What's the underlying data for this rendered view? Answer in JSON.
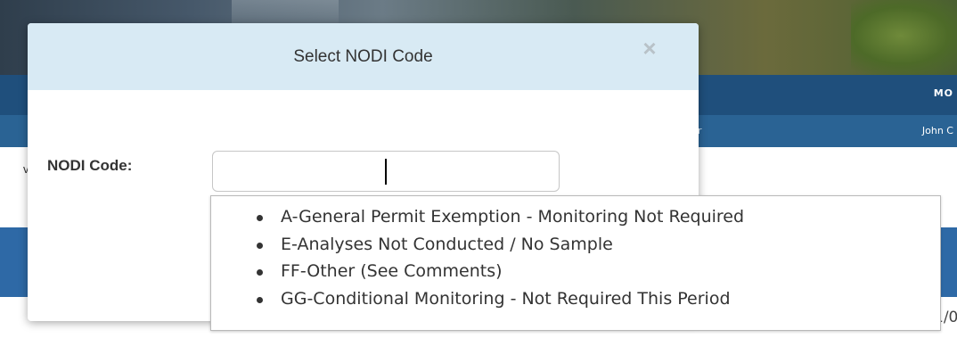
{
  "background": {
    "nav_text": "MO",
    "subnav_left": "r",
    "subnav_right": "John C",
    "edge_char": "v",
    "date_fragment": "1/0"
  },
  "modal": {
    "title": "Select NODI Code",
    "close_symbol": "×",
    "field_label": "NODI Code:",
    "input_value": "",
    "input_placeholder": ""
  },
  "dropdown": {
    "options": [
      "A-General Permit Exemption - Monitoring Not Required",
      "E-Analyses Not Conducted / No Sample",
      "FF-Other (See Comments)",
      "GG-Conditional Monitoring - Not Required This Period"
    ]
  },
  "colors": {
    "modal_header": "#d8eaf4",
    "nav": "#1f4f7c",
    "subnav": "#2a6394",
    "content_bar": "#2e69a6"
  }
}
